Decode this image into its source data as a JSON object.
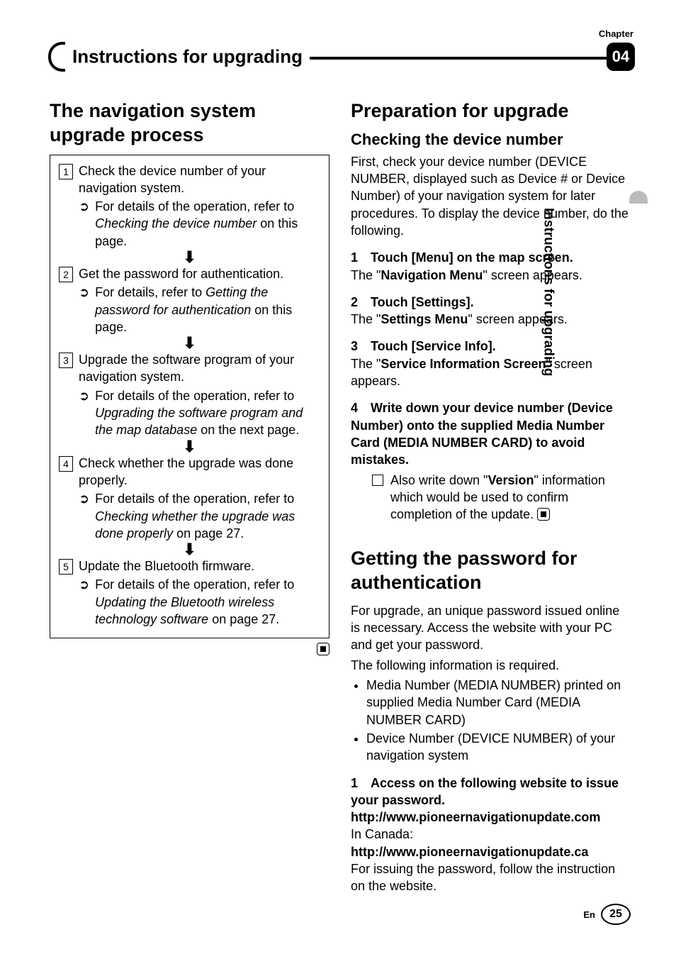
{
  "header": {
    "chapter_label": "Chapter",
    "title": "Instructions for upgrading",
    "number": "04"
  },
  "side_tab": "Instructions for upgrading",
  "left": {
    "title": "The navigation system upgrade process",
    "steps": [
      {
        "n": "1",
        "text": "Check the device number of your navigation system.",
        "detail_pre": "For details of the operation, refer to ",
        "detail_it": "Checking the device number",
        "detail_post": " on this page."
      },
      {
        "n": "2",
        "text": "Get the password for authentication.",
        "detail_pre": "For details, refer to ",
        "detail_it": "Getting the password for authentication",
        "detail_post": " on this page."
      },
      {
        "n": "3",
        "text": "Upgrade the software program of your navigation system.",
        "detail_pre": "For details of the operation, refer to ",
        "detail_it": "Upgrading the software program and the map database",
        "detail_post": " on the next page."
      },
      {
        "n": "4",
        "text": "Check whether the upgrade was done properly.",
        "detail_pre": "For details of the operation, refer to ",
        "detail_it": "Checking whether the upgrade was done properly",
        "detail_post": " on page 27."
      },
      {
        "n": "5",
        "text": "Update the Bluetooth firmware.",
        "detail_pre": "For details of the operation, refer to ",
        "detail_it": "Updating the Bluetooth wireless technology software",
        "detail_post": " on page 27."
      }
    ]
  },
  "right": {
    "prep_title": "Preparation for upgrade",
    "check_title": "Checking the device number",
    "check_intro": "First, check your device number (DEVICE NUMBER, displayed such as Device # or Device Number) of your navigation system for later procedures. To display the device number, do the following.",
    "s1_head_n": "1",
    "s1_head": "Touch [Menu] on the map screen.",
    "s1_after_pre": "The \"",
    "s1_after_b": "Navigation Menu",
    "s1_after_post": "\" screen appears.",
    "s2_head_n": "2",
    "s2_head": "Touch [Settings].",
    "s2_after_pre": "The \"",
    "s2_after_b": "Settings Menu",
    "s2_after_post": "\" screen appears.",
    "s3_head_n": "3",
    "s3_head": "Touch [Service Info].",
    "s3_after_pre": "The \"",
    "s3_after_b": "Service Information Screen",
    "s3_after_post": "\" screen appears.",
    "s4_head_n": "4",
    "s4_head": "Write down your device number (Device Number) onto the supplied Media Number Card (MEDIA NUMBER CARD) to avoid mistakes.",
    "s4_note_pre": "Also write down \"",
    "s4_note_b": "Version",
    "s4_note_post": "\" information which would be used to confirm completion of the update.",
    "pw_title": "Getting the password for authentication",
    "pw_intro1": "For upgrade, an unique password issued online is necessary. Access the website with your PC and get your password.",
    "pw_intro2": "The following information is required.",
    "pw_bullets": [
      "Media Number (MEDIA NUMBER) printed on supplied Media Number Card (MEDIA NUMBER CARD)",
      "Device Number (DEVICE NUMBER) of your navigation system"
    ],
    "pw_s1_n": "1",
    "pw_s1_head": "Access on the following website to issue your password.",
    "pw_url1": "http://www.pioneernavigationupdate.com",
    "pw_canada": "In Canada:",
    "pw_url2": "http://www.pioneernavigationupdate.ca",
    "pw_tail": "For issuing the password, follow the instruction on the website."
  },
  "footer": {
    "lang": "En",
    "page": "25"
  }
}
